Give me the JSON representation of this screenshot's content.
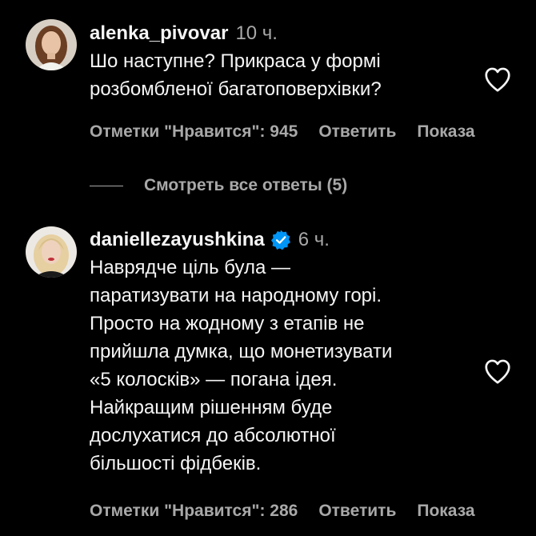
{
  "comments": [
    {
      "username": "alenka_pivovar",
      "time": "10 ч.",
      "verified": false,
      "text_lines": [
        "Шо наступне? Прикраса у формі",
        "розбомбленої багатоповерхівки?"
      ],
      "likes_label": "Отметки \"Нравится\": 945",
      "reply_label": "Ответить",
      "translate_label": "Показа"
    },
    {
      "username": "daniellezayushkina",
      "time": "6 ч.",
      "verified": true,
      "text_lines": [
        "Наврядче ціль була —",
        "паратизувати на народному горі.",
        "Просто на жодному з етапів не",
        "прийшла думка, що монетизувати",
        "«5 колосків» — погана ідея.",
        "Найкращим рішенням буде",
        "дослухатися до абсолютної",
        "більшості фідбеків."
      ],
      "likes_label": "Отметки \"Нравится\": 286",
      "reply_label": "Ответить",
      "translate_label": "Показа"
    }
  ],
  "view_replies_label": "Смотреть все ответы (5)",
  "colors": {
    "background": "#000000",
    "primary_text": "#f5f5f5",
    "secondary_text": "#a8a8a8",
    "verified_badge": "#0095f6"
  },
  "icons": {
    "like": "heart-outline-icon",
    "verified": "verified-badge-icon"
  }
}
